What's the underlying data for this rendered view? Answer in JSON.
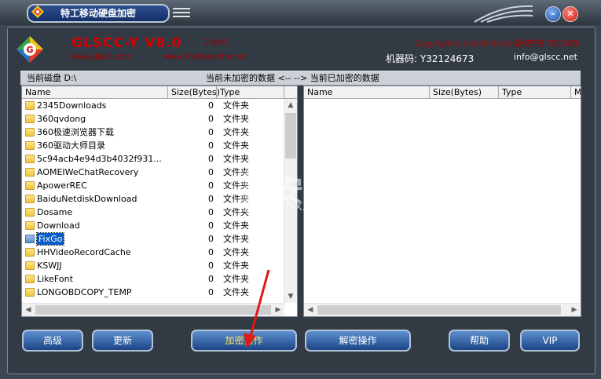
{
  "window": {
    "title": "特工移动硬盘加密",
    "minimize_label": "–",
    "close_label": "✕"
  },
  "header": {
    "brand": "GLSCC-Y  V8.0",
    "version_sub": "2.RAR",
    "site1": "www.glscc.com",
    "site2": "www.theteacomm.cn",
    "copyright": "Copyright (c) 2009-2019 版权所有 特工软件",
    "machine_code": "机器码: Y32124673",
    "email": "info@glscc.net"
  },
  "status": {
    "current_disk": "当前磁盘 D:\\",
    "direction": "当前未加密的数据 <-- --> 当前已加密的数据"
  },
  "left_pane": {
    "columns": [
      "Name",
      "Size(Bytes)",
      "Type"
    ],
    "rows": [
      {
        "name": "2345Downloads",
        "size": "0",
        "type": "文件夹"
      },
      {
        "name": "360qvdong",
        "size": "0",
        "type": "文件夹"
      },
      {
        "name": "360极速浏览器下载",
        "size": "0",
        "type": "文件夹"
      },
      {
        "name": "360驱动大师目录",
        "size": "0",
        "type": "文件夹"
      },
      {
        "name": "5c94acb4e94d3b4032f931...",
        "size": "0",
        "type": "文件夹"
      },
      {
        "name": "AOMEIWeChatRecovery",
        "size": "0",
        "type": "文件夹"
      },
      {
        "name": "ApowerREC",
        "size": "0",
        "type": "文件夹"
      },
      {
        "name": "BaiduNetdiskDownload",
        "size": "0",
        "type": "文件夹"
      },
      {
        "name": "Dosame",
        "size": "0",
        "type": "文件夹"
      },
      {
        "name": "Download",
        "size": "0",
        "type": "文件夹"
      },
      {
        "name": "FixGo",
        "size": "0",
        "type": "文件夹"
      },
      {
        "name": "HHVideoRecordCache",
        "size": "0",
        "type": "文件夹"
      },
      {
        "name": "KSWJJ",
        "size": "0",
        "type": "文件夹"
      },
      {
        "name": "LikeFont",
        "size": "0",
        "type": "文件夹"
      },
      {
        "name": "LONGOBDCOPY_TEMP",
        "size": "0",
        "type": "文件夹"
      }
    ],
    "selected": "FixGo"
  },
  "right_pane": {
    "columns": [
      "Name",
      "Size(Bytes)",
      "Type",
      "M"
    ]
  },
  "buttons": {
    "advanced": "高级",
    "refresh": "更新",
    "encrypt": "加密操作",
    "decrypt": "解密操作",
    "help": "帮助",
    "vip": "VIP"
  },
  "watermark": {
    "text": "安下载",
    "sub": "anxz.com"
  },
  "colors": {
    "accent_red": "#d60000",
    "selection": "#0a5cc8",
    "button_blue": "#1b4486"
  }
}
